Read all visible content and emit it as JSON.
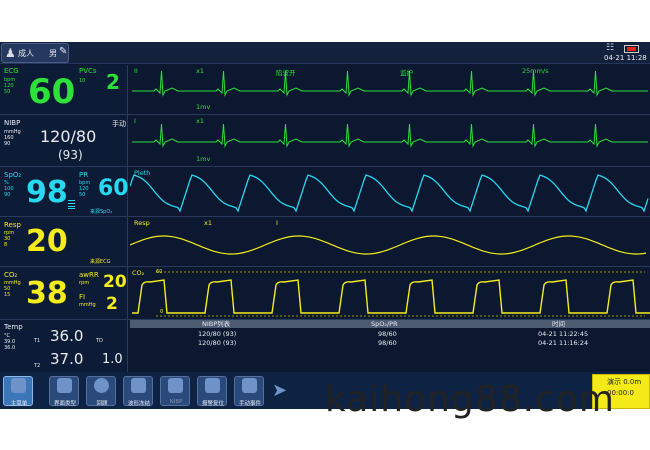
{
  "header": {
    "patient_type": "成人",
    "gender": "男",
    "datetime": "04-21 11:28"
  },
  "ecg": {
    "label": "ECG",
    "unit": "bpm",
    "lim_hi": "120",
    "lim_lo": "50",
    "value": "60",
    "pvcs_label": "PVCs",
    "pvcs_lim": "10",
    "pvcs_value": "2",
    "wave_lead": "II",
    "wave_gain": "x1",
    "wave_filter": "陷波开",
    "wave_mode": "监护",
    "wave_speed": "25mm/s",
    "cal": "1mv"
  },
  "ecg2": {
    "wave_lead": "I",
    "wave_gain": "x1",
    "cal": "1mv"
  },
  "nibp": {
    "label": "NIBP",
    "unit": "mmHg",
    "lim_hi": "160",
    "lim_lo": "90",
    "mode": "手动",
    "sys_dia": "120/80",
    "mean": "(93)"
  },
  "spo2": {
    "label": "SpO₂",
    "unit": "%",
    "lim_hi": "100",
    "lim_lo": "90",
    "value": "98",
    "pr_label": "PR",
    "pr_unit": "bpm",
    "pr_hi": "120",
    "pr_lo": "50",
    "pr_value": "60",
    "pr_source": "来源SpO₂",
    "wave_label": "Pleth"
  },
  "resp": {
    "label": "Resp",
    "unit": "rpm",
    "lim_hi": "30",
    "lim_lo": "8",
    "value": "20",
    "source": "来源ECG",
    "wave_label": "Resp",
    "wave_gain": "x1",
    "wave_lead": "I"
  },
  "co2": {
    "label": "CO₂",
    "unit": "mmHg",
    "lim_hi": "50",
    "lim_lo": "15",
    "value": "38",
    "awrr_label": "awRR",
    "awrr_unit": "rpm",
    "awrr_value": "20",
    "fi_label": "FI",
    "fi_unit": "mmHg",
    "fi_value": "2",
    "wave_label": "CO₂",
    "scale_hi": "60",
    "scale_lo": "0"
  },
  "temp": {
    "label": "Temp",
    "unit": "°C",
    "lim_hi": "39.0",
    "lim_lo": "36.0",
    "t1_label": "T1",
    "t1_value": "36.0",
    "t2_label": "T2",
    "t2_value": "37.0",
    "td_label": "TD",
    "td_value": "1.0"
  },
  "nibp_list": {
    "headers": [
      "NIBP列表",
      "SpO₂/PR",
      "时间"
    ],
    "rows": [
      [
        "120/80 (93)",
        "98/60",
        "04-21 11:22:45"
      ],
      [
        "120/80 (93)",
        "98/60",
        "04-21 11:16:24"
      ]
    ]
  },
  "toolbar": {
    "items": [
      "主菜单",
      "界面类型",
      "回顾",
      "波形冻结",
      "NIBP",
      "报警复位",
      "手动事件"
    ]
  },
  "demo": {
    "line1": "演示 0.0m",
    "line2": "00:00:0"
  },
  "watermark": "kaihong88.com",
  "colors": {
    "ecg": "#2ee03a",
    "spo2": "#27d8f0",
    "resp": "#f4ec1c",
    "background": "#0b1830"
  }
}
